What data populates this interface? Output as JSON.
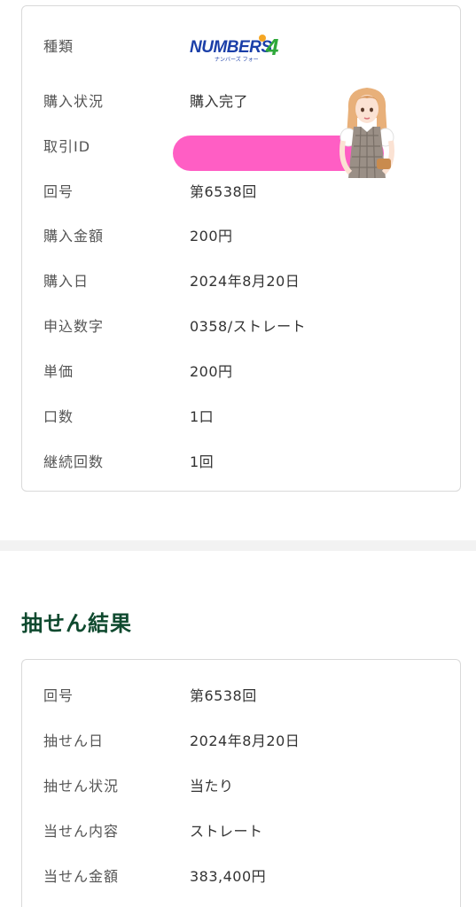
{
  "purchase": {
    "type_label": "種類",
    "logo": {
      "brand": "NUMBERS4",
      "subtext": "ナンバーズ フォー",
      "colors": [
        "#1b3fa8",
        "#2fa83a",
        "#f5a623"
      ]
    },
    "rows": [
      {
        "label": "購入状況",
        "value": "購入完了"
      },
      {
        "label": "取引ID",
        "value": ""
      },
      {
        "label": "回号",
        "value": "第6538回"
      },
      {
        "label": "購入金額",
        "value": "200円"
      },
      {
        "label": "購入日",
        "value": "2024年8月20日"
      },
      {
        "label": "申込数字",
        "value": "0358/ストレート"
      },
      {
        "label": "単価",
        "value": "200円"
      },
      {
        "label": "口数",
        "value": "1口"
      },
      {
        "label": "継続回数",
        "value": "1回"
      }
    ]
  },
  "result": {
    "title": "抽せん結果",
    "rows": [
      {
        "label": "回号",
        "value": "第6538回"
      },
      {
        "label": "抽せん日",
        "value": "2024年8月20日"
      },
      {
        "label": "抽せん状況",
        "value": "当たり"
      },
      {
        "label": "当せん内容",
        "value": "ストレート"
      },
      {
        "label": "当せん金額",
        "value": "383,400円"
      }
    ]
  },
  "colors": {
    "title_green": "#0f4a2f",
    "redaction_pink": "#ff5ec4",
    "border": "#d9d9d9",
    "divider": "#f2f2f2"
  }
}
